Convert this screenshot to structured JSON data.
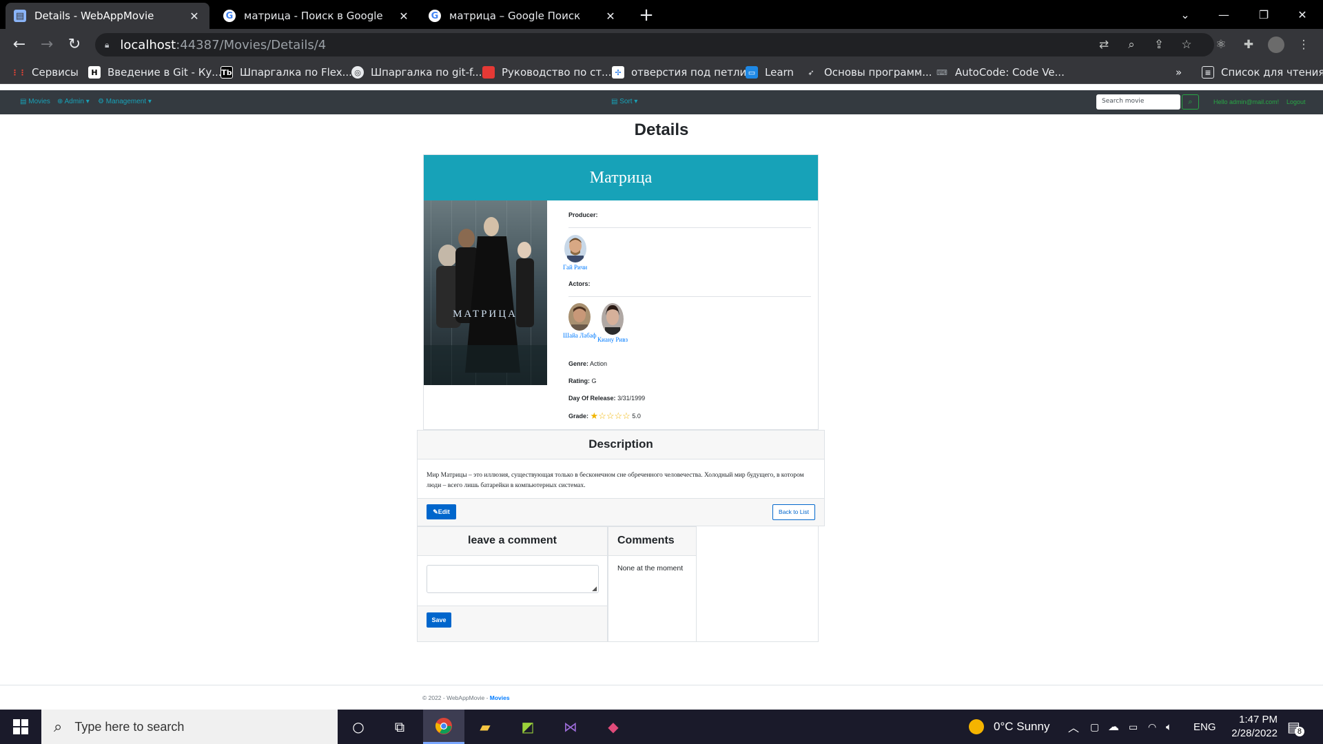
{
  "browser": {
    "tabs": [
      {
        "title": "Details - WebAppMovie",
        "active": true
      },
      {
        "title": "матрица - Поиск в Google",
        "active": false
      },
      {
        "title": "матрица – Google Поиск",
        "active": false
      }
    ],
    "url_host": "localhost",
    "url_rest": ":44387/Movies/Details/4",
    "bookmarks": [
      {
        "label": "Сервисы"
      },
      {
        "label": "Введение в Git - Ку..."
      },
      {
        "label": "Шпаргалка по Flex..."
      },
      {
        "label": "Шпаргалка по git-f..."
      },
      {
        "label": "Руководство по ст..."
      },
      {
        "label": "отверстия под петли"
      },
      {
        "label": "Learn"
      },
      {
        "label": "Основы программ..."
      },
      {
        "label": "AutoCode: Code Ve..."
      }
    ],
    "bookmarks_more": "»",
    "reading_list": "Список для чтения"
  },
  "appnav": {
    "movies": "Movies",
    "admin": "Admin",
    "management": "Management",
    "sort": "Sort",
    "search_placeholder": "Search movie",
    "greeting": "Hello admin@mail.com!",
    "logout": "Logout"
  },
  "page": {
    "title": "Details"
  },
  "movie": {
    "name": "Матрица",
    "poster_caption": "МАТРИЦА",
    "producer_label": "Producer:",
    "producer": {
      "name": "Гай Ричи"
    },
    "actors_label": "Actors:",
    "actors": [
      {
        "name": "Шайа Лабаф"
      },
      {
        "name": "Киану Ривз"
      }
    ],
    "genre_label": "Genre:",
    "genre": "Action",
    "rating_label": "Rating:",
    "rating": "G",
    "release_label": "Day Of Release:",
    "release": "3/31/1999",
    "grade_label": "Grade:",
    "grade": "5.0",
    "grade_stars_filled": 1,
    "grade_stars_total": 5
  },
  "description": {
    "header": "Description",
    "text": "Мир Матрицы – это иллюзия, существующая только в бесконечном сне обреченного человечества. Холодный мир будущего, в котором люди – всего лишь батарейки в компьютерных системах.",
    "edit_label": "Edit",
    "back_label": "Back to List"
  },
  "comment_form": {
    "header": "leave a comment",
    "save_label": "Save"
  },
  "comments": {
    "header": "Comments",
    "empty_text": "None at the moment"
  },
  "footer": {
    "text": "© 2022 - WebAppMovie - ",
    "link": "Movies"
  },
  "taskbar": {
    "search_placeholder": "Type here to search",
    "weather": "0°C  Sunny",
    "lang": "ENG",
    "time": "1:47 PM",
    "date": "2/28/2022",
    "notifications": "8"
  },
  "colors": {
    "accent": "#17a2b8",
    "primary": "#0066cc",
    "navbar": "#343a40",
    "success": "#28a745"
  }
}
